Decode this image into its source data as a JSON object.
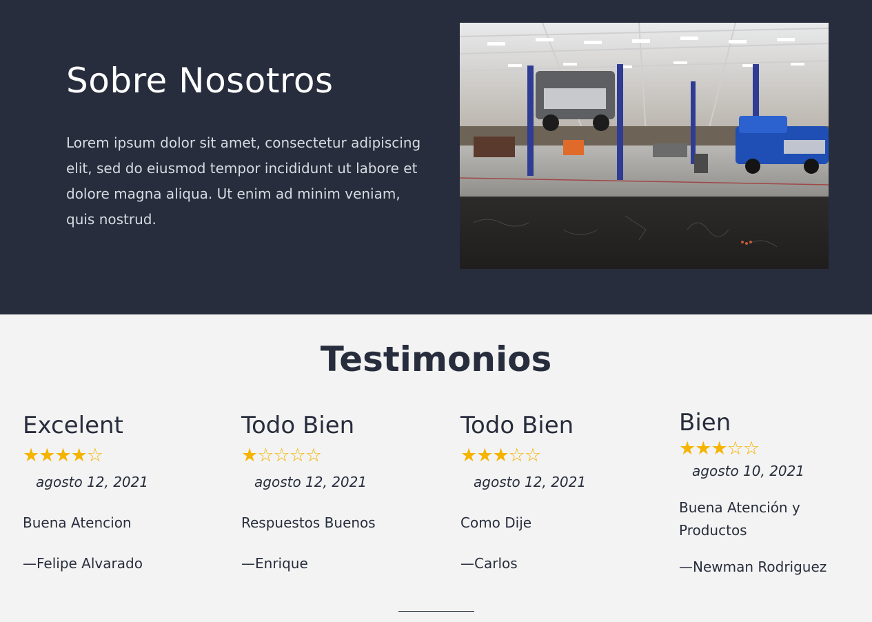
{
  "about": {
    "title": "Sobre Nosotros",
    "text": "Lorem ipsum dolor sit amet, consectetur adipiscing elit, sed do eiusmod tempor incididunt ut labore et dolore magna aliqua. Ut enim ad minim veniam, quis nostrud.",
    "image_desc": "auto-repair-garage-photo"
  },
  "testimonials": {
    "title": "Testimonios",
    "star_color": "#f5b400",
    "items": [
      {
        "title": "Excelent",
        "rating": 4,
        "max": 5,
        "date": "agosto 12, 2021",
        "quote": "Buena Atencion",
        "author": "—Felipe Alvarado"
      },
      {
        "title": "Todo Bien",
        "rating": 1,
        "max": 5,
        "date": "agosto 12, 2021",
        "quote": "Respuestos Buenos",
        "author": "—Enrique"
      },
      {
        "title": "Todo Bien",
        "rating": 3,
        "max": 5,
        "date": "agosto 12, 2021",
        "quote": "Como Dije",
        "author": "—Carlos"
      },
      {
        "title": "Bien",
        "rating": 3,
        "max": 5,
        "date": "agosto 10, 2021",
        "quote": "Buena Atención y Productos",
        "author": "—Newman Rodriguez"
      }
    ]
  },
  "colors": {
    "dark": "#272d3c",
    "light_bg": "#f3f3f3"
  }
}
